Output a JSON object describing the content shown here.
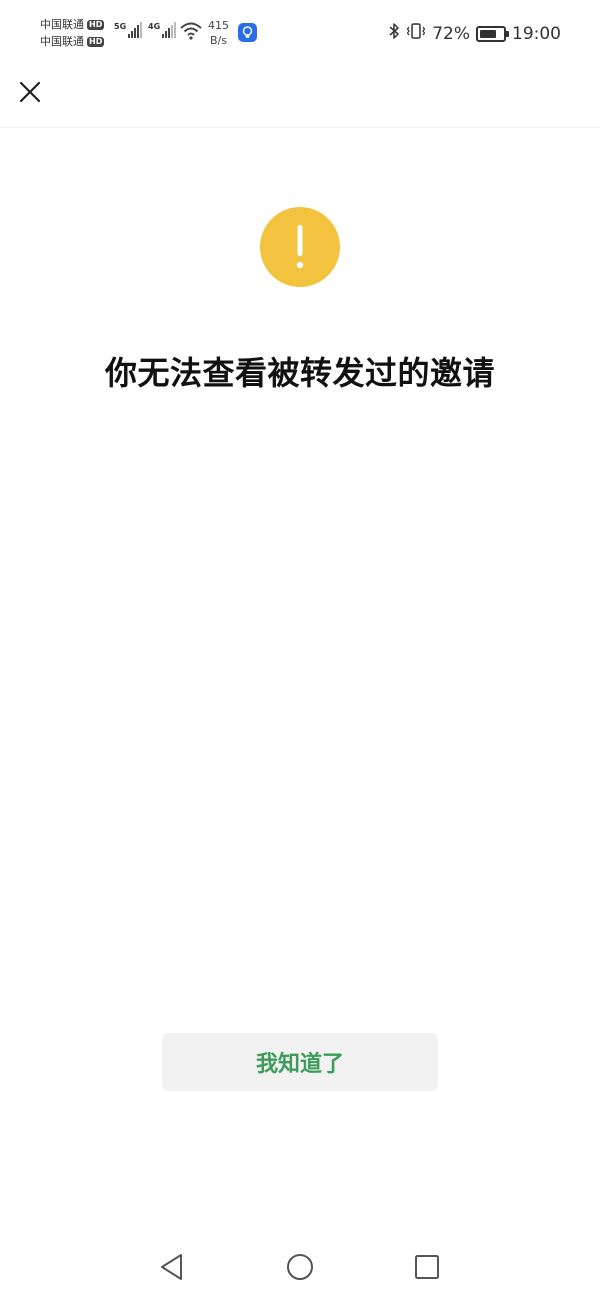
{
  "status_bar": {
    "carrier1": "中国联通",
    "carrier2": "中国联通",
    "hd_label": "HD",
    "signal1_gen": "5G",
    "signal2_gen": "4G",
    "net_speed_value": "415",
    "net_speed_unit": "B/s",
    "battery_percent": "72%",
    "battery_level": 0.72,
    "time": "19:00",
    "icons": [
      "signal-icon",
      "wifi-icon",
      "app-notification-icon",
      "bluetooth-icon",
      "vibrate-icon",
      "battery-icon"
    ]
  },
  "header": {
    "close_icon": "close-icon"
  },
  "main": {
    "warning_icon": "warning-icon",
    "warning_color": "#f3c33f",
    "title": "你无法查看被转发过的邀请"
  },
  "actions": {
    "ok_label": "我知道了",
    "ok_color": "#3d9c5a"
  },
  "nav_bar": {
    "icons": [
      "back-icon",
      "home-icon",
      "recents-icon"
    ]
  }
}
